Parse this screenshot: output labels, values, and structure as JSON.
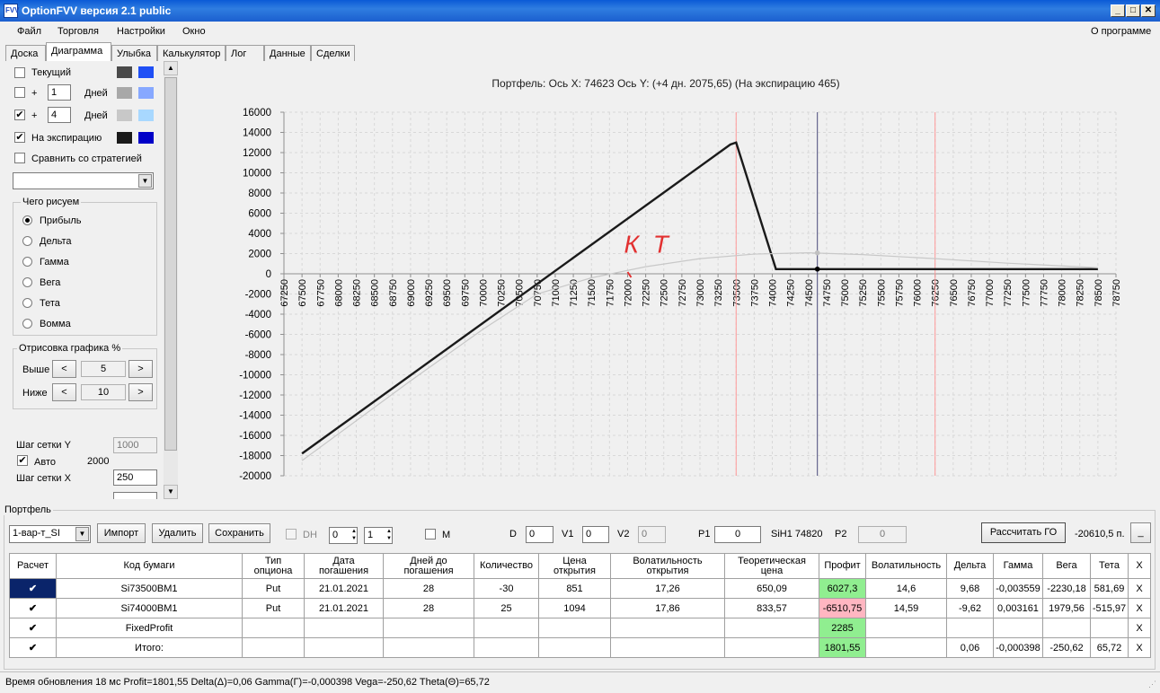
{
  "window": {
    "title": "OptionFVV версия 2.1 public",
    "icon_text": "FVV"
  },
  "menu": {
    "items": [
      "Файл",
      "Торговля",
      "Настройки",
      "Окно"
    ],
    "about": "О программе"
  },
  "tabs": [
    "Доска",
    "Диаграмма",
    "Улыбка",
    "Калькулятор",
    "Лог",
    "Данные",
    "Сделки"
  ],
  "active_tab": "Диаграмма",
  "left": {
    "current_label": "Текущий",
    "plus": "+",
    "days_label": "Дней",
    "days1": "1",
    "days2": "4",
    "expiration_label": "На экспирацию",
    "compare_label": "Сравнить со стратегией",
    "compare_select": "",
    "what_group": "Чего рисуем",
    "radios": [
      "Прибыль",
      "Дельта",
      "Гамма",
      "Вега",
      "Тета",
      "Вомма"
    ],
    "draw_group": "Отрисовка графика %",
    "above_label": "Выше",
    "above_value": "5",
    "below_label": "Ниже",
    "below_value": "10",
    "grid_y_label": "Шаг сетки Y",
    "grid_y_value": "1000",
    "auto_label": "Авто",
    "auto_value": "2000",
    "grid_x_label": "Шаг сетки X",
    "grid_x_value": "250",
    "lt": "<",
    "gt": ">",
    "colors": {
      "cur1": "#4a4a4a",
      "cur2": "#1f4ff5",
      "d1a": "#a8a8a8",
      "d1b": "#87a8ff",
      "d4a": "#c8c8c8",
      "d4b": "#a8d8ff",
      "expa": "#1a1a1a",
      "expb": "#0000c8"
    }
  },
  "chart_data": {
    "type": "line",
    "title": "Портфель: Ось X: 74623 Ось Y:  (+4 дн. 2075,65)  (На экспирацию 465)",
    "xlim": [
      67250,
      78750
    ],
    "ylim": [
      -20000,
      16000
    ],
    "x_ticks": [
      67250,
      67500,
      67750,
      68000,
      68250,
      68500,
      68750,
      69000,
      69250,
      69500,
      69750,
      70000,
      70250,
      70500,
      70750,
      71000,
      71250,
      71500,
      71750,
      72000,
      72250,
      72500,
      72750,
      73000,
      73250,
      73500,
      73750,
      74000,
      74250,
      74500,
      74750,
      75000,
      75250,
      75500,
      75750,
      76000,
      76250,
      76500,
      76750,
      77000,
      77250,
      77500,
      77750,
      78000,
      78250,
      78500,
      78750
    ],
    "y_ticks": [
      16000,
      14000,
      12000,
      10000,
      8000,
      6000,
      4000,
      2000,
      0,
      -2000,
      -4000,
      -6000,
      -8000,
      -10000,
      -12000,
      -14000,
      -16000,
      -18000,
      -20000
    ],
    "grid": true,
    "series": [
      {
        "color": "#1a1a1a",
        "x": [
          67500,
          73420,
          73500,
          74050,
          78500
        ],
        "y": [
          -17800,
          12800,
          13000,
          465,
          465
        ]
      },
      {
        "color": "#c8c8c8",
        "x": [
          67500,
          69000,
          70000,
          70750,
          71500,
          72250,
          73000,
          73750,
          74500,
          75250,
          76250,
          77250,
          78500
        ],
        "y": [
          -18500,
          -10600,
          -5500,
          -2000,
          -400,
          700,
          1500,
          1950,
          2075,
          1900,
          1500,
          1050,
          600
        ]
      }
    ],
    "markers": [
      {
        "x": 74623,
        "y": 465,
        "color": "#000"
      },
      {
        "x": 74623,
        "y": 2075,
        "color": "#c0c0c0"
      }
    ],
    "vlines": [
      {
        "x": 73500,
        "color": "#ff9999"
      },
      {
        "x": 74623,
        "color": "#4a4a7a"
      },
      {
        "x": 76250,
        "color": "#ff9999"
      }
    ],
    "annotation": {
      "text": "К Т",
      "color": "#e23030"
    }
  },
  "portfolio": {
    "title": "Портфель",
    "select_value": "1-вар-т_SI",
    "import": "Импорт",
    "delete": "Удалить",
    "save": "Сохранить",
    "dh": "DH",
    "spin1": "0",
    "spin2": "1",
    "m": "M",
    "d_label": "D",
    "d_value": "0",
    "v1_label": "V1",
    "v1_value": "0",
    "v2_label": "V2",
    "v2_value": "0",
    "p1_label": "P1",
    "p1_value": "0",
    "instrument": "SiH1 74820",
    "p2_label": "P2",
    "p2_value": "0",
    "calc_go": "Рассчитать ГО",
    "go_value": "-20610,5 п.",
    "minimize": "_"
  },
  "table": {
    "headers": [
      "Расчет",
      "Код бумаги",
      "Тип\nопциона",
      "Дата\nпогашения",
      "Дней до\nпогашения",
      "Количество",
      "Цена\nоткрытия",
      "Волатильность\nоткрытия",
      "Теоретическая\nцена",
      "Профит",
      "Волатильность",
      "Дельта",
      "Гамма",
      "Вега",
      "Тета",
      "X"
    ],
    "rows": [
      [
        "✔",
        "Si73500BM1",
        "Put",
        "21.01.2021",
        "28",
        "-30",
        "851",
        "17,26",
        "650,09",
        "6027,3",
        "14,6",
        "9,68",
        "-0,003559",
        "-2230,18",
        "581,69",
        "X"
      ],
      [
        "✔",
        "Si74000BM1",
        "Put",
        "21.01.2021",
        "28",
        "25",
        "1094",
        "17,86",
        "833,57",
        "-6510,75",
        "14,59",
        "-9,62",
        "0,003161",
        "1979,56",
        "-515,97",
        "X"
      ],
      [
        "✔",
        "FixedProfit",
        "",
        "",
        "",
        "",
        "",
        "",
        "",
        "2285",
        "",
        "",
        "",
        "",
        "",
        "X"
      ],
      [
        "✔",
        "Итого:",
        "",
        "",
        "",
        "",
        "",
        "",
        "",
        "1801,55",
        "",
        "0,06",
        "-0,000398",
        "-250,62",
        "65,72",
        "X"
      ]
    ]
  },
  "status": {
    "text": "Время обновления 18 мс  Profit=1801,55 Delta(Δ)=0,06 Gamma(Γ)=-0,000398 Vega=-250,62 Theta(Θ)=65,72"
  }
}
